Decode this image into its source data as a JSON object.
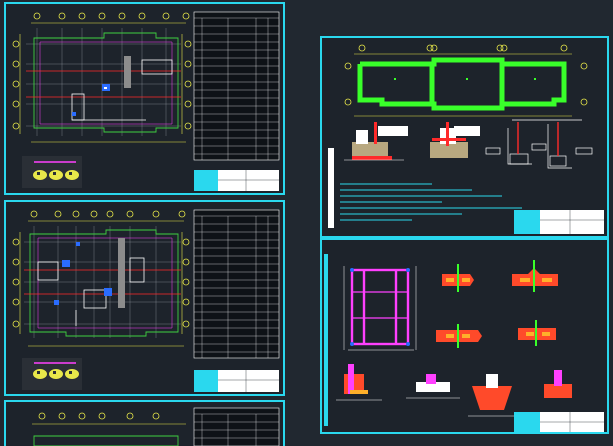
{
  "viewer": {
    "background_color": "#212830",
    "sheet_frame_color": "#2ad8ee"
  },
  "sheets": [
    {
      "id": "plan-sheet-1",
      "type": "floor-plan-with-table"
    },
    {
      "id": "plan-sheet-2",
      "type": "floor-plan-with-table"
    },
    {
      "id": "plan-sheet-3",
      "type": "floor-plan-with-table",
      "partially_visible": true
    },
    {
      "id": "detail-sheet-1",
      "type": "foundation-plan-and-sections"
    },
    {
      "id": "detail-sheet-2",
      "type": "reinforcement-details"
    }
  ],
  "colors": {
    "axis_line": "#ff2a2a",
    "dimension": "#e8e84a",
    "outline_green": "#40d040",
    "highlight_green": "#39ff2a",
    "magenta": "#ff40ff",
    "grid": "#9aa0a8",
    "table_ink": "#ffffff",
    "paper": "#ffffff",
    "accent_blue": "#2a6cff",
    "title_block_cyan": "#2ad8ee"
  }
}
